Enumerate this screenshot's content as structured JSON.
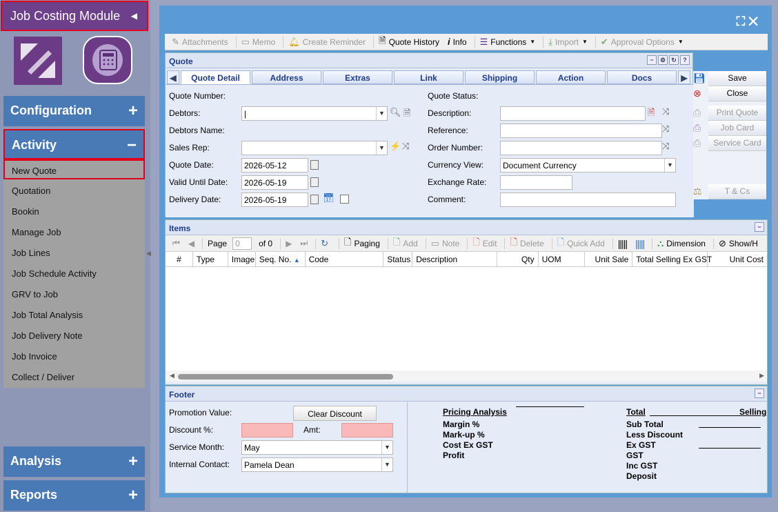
{
  "sidebar": {
    "module_title": "Job Costing Module",
    "sections": {
      "configuration": "Configuration",
      "activity": "Activity",
      "analysis": "Analysis",
      "reports": "Reports"
    },
    "activity_items": [
      "New Quote",
      "Quotation",
      "Bookin",
      "Manage Job",
      "Job Lines",
      "Job Schedule Activity",
      "GRV to Job",
      "Job Total Analysis",
      "Job Delivery Note",
      "Job Invoice",
      "Collect / Deliver"
    ]
  },
  "toolbar": {
    "attachments": "Attachments",
    "memo": "Memo",
    "create_reminder": "Create Reminder",
    "quote_history": "Quote History",
    "info": "Info",
    "functions": "Functions",
    "import": "Import",
    "approval_options": "Approval Options"
  },
  "quote": {
    "title": "Quote",
    "tabs": [
      "Quote Detail",
      "Address",
      "Extras",
      "Link",
      "Shipping",
      "Action",
      "Docs"
    ],
    "labels": {
      "quote_number": "Quote Number:",
      "debtors": "Debtors:",
      "debtors_name": "Debtors Name:",
      "sales_rep": "Sales Rep:",
      "quote_date": "Quote Date:",
      "valid_until": "Valid Until Date:",
      "delivery_date": "Delivery Date:",
      "quote_status": "Quote Status:",
      "description": "Description:",
      "reference": "Reference:",
      "order_number": "Order Number:",
      "currency_view": "Currency View:",
      "exchange_rate": "Exchange Rate:",
      "comment": "Comment:"
    },
    "values": {
      "quote_date": "2026-05-12",
      "valid_until": "2026-05-19",
      "delivery_date": "2026-05-19",
      "currency_view": "Document Currency"
    }
  },
  "side_actions": {
    "save": "Save",
    "close": "Close",
    "print_quote": "Print Quote",
    "job_card": "Job Card",
    "service_card": "Service Card",
    "tcs": "T & Cs"
  },
  "items": {
    "title": "Items",
    "page_label": "Page",
    "page_value": "0",
    "of_label": "of 0",
    "paging": "Paging",
    "add": "Add",
    "note": "Note",
    "edit": "Edit",
    "delete": "Delete",
    "quick_add": "Quick Add",
    "dimension": "Dimension",
    "show_hide": "Show/H",
    "columns": [
      "#",
      "Type",
      "Image",
      "Seq. No.",
      "Code",
      "Status",
      "Description",
      "Qty",
      "UOM",
      "Unit Sale",
      "Total Selling Ex GST",
      "Unit Cost"
    ]
  },
  "footer": {
    "title": "Footer",
    "promotion_value": "Promotion Value:",
    "clear_discount": "Clear Discount",
    "discount_pct": "Discount %:",
    "amt": "Amt:",
    "service_month": "Service Month:",
    "service_month_value": "May",
    "internal_contact": "Internal Contact:",
    "internal_contact_value": "Pamela Dean",
    "pricing_analysis": "Pricing Analysis",
    "margin": "Margin %",
    "markup": "Mark-up %",
    "cost_ex_gst": "Cost Ex GST",
    "profit": "Profit",
    "total": "Total",
    "selling": "Selling",
    "sub_total": "Sub Total",
    "less_discount": "Less Discount",
    "ex_gst": "Ex GST",
    "gst": "GST",
    "inc_gst": "Inc GST",
    "deposit": "Deposit"
  }
}
